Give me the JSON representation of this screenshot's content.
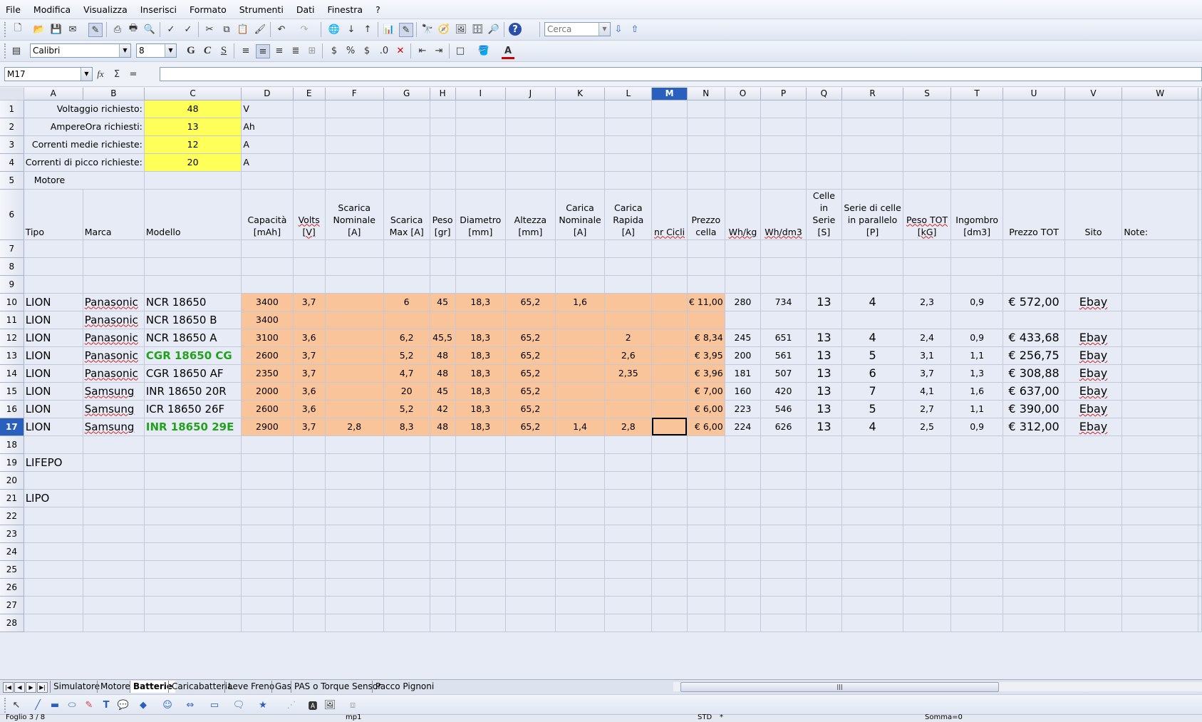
{
  "menu": [
    "File",
    "Modifica",
    "Visualizza",
    "Inserisci",
    "Formato",
    "Strumenti",
    "Dati",
    "Finestra",
    "?"
  ],
  "toolbar": {
    "search_placeholder": "Cerca",
    "font_name": "Calibri",
    "font_size": "8",
    "bold": "G",
    "italic": "C",
    "underline": "S"
  },
  "formula_bar": {
    "cell_ref": "M17",
    "value": ""
  },
  "columns": [
    "A",
    "B",
    "C",
    "D",
    "E",
    "F",
    "G",
    "H",
    "I",
    "J",
    "K",
    "L",
    "M",
    "N",
    "O",
    "P",
    "Q",
    "R",
    "S",
    "T",
    "U",
    "V",
    "W"
  ],
  "params": [
    {
      "label": "Voltaggio richiesto:",
      "value": "48",
      "unit": "V"
    },
    {
      "label": "AmpereOra richiesti:",
      "value": "13",
      "unit": "Ah"
    },
    {
      "label": "Correnti medie richieste:",
      "value": "12",
      "unit": "A"
    },
    {
      "label": "Correnti di picco richieste:",
      "value": "20",
      "unit": "A"
    }
  ],
  "motore_label": "Motore",
  "headers": [
    "Tipo",
    "Marca",
    "Modello",
    "Capacità [mAh]",
    "Volts [V]",
    "Scarica Nominale [A]",
    "Scarica Max [A]",
    "Peso [gr]",
    "Diametro [mm]",
    "Altezza [mm]",
    "Carica Nominale [A]",
    "Carica Rapida [A]",
    "nr Cicli",
    "Prezzo cella",
    "Wh/kg",
    "Wh/dm3",
    "Celle in Serie [S]",
    "Serie di celle in parallelo [P]",
    "Peso TOT [kG]",
    "Ingombro [dm3]",
    "Prezzo TOT",
    "Sito",
    "Note:"
  ],
  "batteries": [
    [
      "LION",
      "Panasonic",
      "NCR 18650",
      "3400",
      "3,7",
      "",
      "6",
      "45",
      "18,3",
      "65,2",
      "1,6",
      "",
      "",
      "€ 11,00",
      "280",
      "734",
      "13",
      "4",
      "2,3",
      "0,9",
      "€ 572,00",
      "Ebay",
      ""
    ],
    [
      "LION",
      "Panasonic",
      "NCR 18650 B",
      "3400",
      "",
      "",
      "",
      "",
      "",
      "",
      "",
      "",
      "",
      "",
      "",
      "",
      "",
      "",
      "",
      "",
      "",
      "",
      ""
    ],
    [
      "LION",
      "Panasonic",
      "NCR 18650 A",
      "3100",
      "3,6",
      "",
      "6,2",
      "45,5",
      "18,3",
      "65,2",
      "",
      "2",
      "",
      "€ 8,34",
      "245",
      "651",
      "13",
      "4",
      "2,4",
      "0,9",
      "€ 433,68",
      "Ebay",
      ""
    ],
    [
      "LION",
      "Panasonic",
      "CGR 18650 CG",
      "2600",
      "3,7",
      "",
      "5,2",
      "48",
      "18,3",
      "65,2",
      "",
      "2,6",
      "",
      "€ 3,95",
      "200",
      "561",
      "13",
      "5",
      "3,1",
      "1,1",
      "€ 256,75",
      "Ebay",
      ""
    ],
    [
      "LION",
      "Panasonic",
      "CGR 18650 AF",
      "2350",
      "3,7",
      "",
      "4,7",
      "48",
      "18,3",
      "65,2",
      "",
      "2,35",
      "",
      "€ 3,96",
      "181",
      "507",
      "13",
      "6",
      "3,7",
      "1,3",
      "€ 308,88",
      "Ebay",
      ""
    ],
    [
      "LION",
      "Samsung",
      "INR  18650 20R",
      "2000",
      "3,6",
      "",
      "20",
      "45",
      "18,3",
      "65,2",
      "",
      "",
      "",
      "€ 7,00",
      "160",
      "420",
      "13",
      "7",
      "4,1",
      "1,6",
      "€ 637,00",
      "Ebay",
      ""
    ],
    [
      "LION",
      "Samsung",
      "ICR  18650 26F",
      "2600",
      "3,6",
      "",
      "5,2",
      "42",
      "18,3",
      "65,2",
      "",
      "",
      "",
      "€ 6,00",
      "223",
      "546",
      "13",
      "5",
      "2,7",
      "1,1",
      "€ 390,00",
      "Ebay",
      ""
    ],
    [
      "LION",
      "Samsung",
      "INR  18650 29E",
      "2900",
      "3,7",
      "2,8",
      "8,3",
      "48",
      "18,3",
      "65,2",
      "1,4",
      "2,8",
      "",
      "€ 6,00",
      "224",
      "626",
      "13",
      "4",
      "2,5",
      "0,9",
      "€ 312,00",
      "Ebay",
      ""
    ]
  ],
  "section_labels": {
    "lifepo": "LIFEPO",
    "lipo": "LIPO"
  },
  "sheet_tabs": [
    "Simulatore",
    "Motore",
    "Batterie",
    "Caricabatteria",
    "Leve Freno",
    "Gas",
    "PAS o Torque Sensor",
    "Pacco Pignoni"
  ],
  "active_tab": "Batterie",
  "status": {
    "sheet": "Foglio 3 / 8",
    "style": "mp1",
    "mode": "STD",
    "modified": "*",
    "sum": "Somma=0"
  }
}
